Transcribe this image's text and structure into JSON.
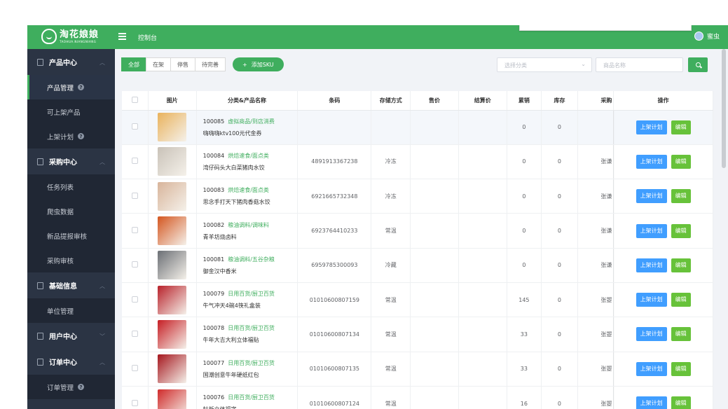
{
  "header": {
    "logo_cn": "淘花娘娘",
    "logo_en": "TAOHUA.NIANGNIANG",
    "title": "控制台",
    "user_name": "蜜虫"
  },
  "sidebar": {
    "groups": [
      {
        "label": "产品中心",
        "items": [
          {
            "label": "产品管理",
            "help": "?"
          },
          {
            "label": "可上架产品"
          },
          {
            "label": "上架计划",
            "help": "?"
          }
        ]
      },
      {
        "label": "采购中心",
        "items": [
          {
            "label": "任务列表"
          },
          {
            "label": "爬虫数据"
          },
          {
            "label": "新品提报审核"
          },
          {
            "label": "采购审核"
          }
        ]
      },
      {
        "label": "基础信息",
        "items": [
          {
            "label": "单位管理"
          }
        ]
      },
      {
        "label": "用户中心",
        "items": []
      },
      {
        "label": "订单中心",
        "items": [
          {
            "label": "订单管理",
            "help": "?"
          }
        ]
      }
    ]
  },
  "toolbar": {
    "filters": [
      "全部",
      "在架",
      "停售",
      "待完善"
    ],
    "add_sku": "添加SKU",
    "category_placeholder": "选择分类",
    "name_placeholder": "商品名称"
  },
  "table": {
    "headers": [
      "图片",
      "分类&产品名称",
      "条码",
      "存储方式",
      "售价",
      "结算价",
      "累销",
      "库存",
      "采购",
      "操作"
    ],
    "plan_label": "上架计划",
    "edit_label": "编辑",
    "rows": [
      {
        "id": "100085",
        "category": "虚拟商品/到店消费",
        "name": "嗨嗨嗨ktv100元代金券",
        "barcode": "",
        "storage": "",
        "price": "",
        "settle": "",
        "sales": "0",
        "stock": "0",
        "purchaser": "",
        "img_color": "#e9b25c"
      },
      {
        "id": "100084",
        "category": "烘焙速食/面点类",
        "name": "湾仔码头大白菜猪肉水饺",
        "barcode": "4891913367238",
        "storage": "冷冻",
        "price": "",
        "settle": "",
        "sales": "0",
        "stock": "0",
        "purchaser": "张谦",
        "img_color": "#c9c2b8"
      },
      {
        "id": "100083",
        "category": "烘焙速食/面点类",
        "name": "思念手打天下猪肉香菇水饺",
        "barcode": "6921665732348",
        "storage": "冷冻",
        "price": "",
        "settle": "",
        "sales": "0",
        "stock": "0",
        "purchaser": "张谦",
        "img_color": "#d8b49a"
      },
      {
        "id": "100082",
        "category": "粮油调料/调味料",
        "name": "青羊坊烧卤料",
        "barcode": "6923764410233",
        "storage": "常温",
        "price": "",
        "settle": "",
        "sales": "0",
        "stock": "0",
        "purchaser": "张谦",
        "img_color": "#d4561f"
      },
      {
        "id": "100081",
        "category": "粮油调料/五谷杂粮",
        "name": "御金汉中香米",
        "barcode": "6959785300093",
        "storage": "冷藏",
        "price": "",
        "settle": "",
        "sales": "0",
        "stock": "0",
        "purchaser": "张谦",
        "img_color": "#6b6f75"
      },
      {
        "id": "100079",
        "category": "日用百货/厨卫百货",
        "name": "牛气冲天4碗4筷礼盒装",
        "barcode": "01010600807159",
        "storage": "常温",
        "price": "",
        "settle": "",
        "sales": "145",
        "stock": "0",
        "purchaser": "张曌",
        "img_color": "#b8212a"
      },
      {
        "id": "100078",
        "category": "日用百货/厨卫百货",
        "name": "牛年大吉大利立体福贴",
        "barcode": "01010600807134",
        "storage": "常温",
        "price": "",
        "settle": "",
        "sales": "33",
        "stock": "0",
        "purchaser": "张曌",
        "img_color": "#c61e24"
      },
      {
        "id": "100077",
        "category": "日用百货/厨卫百货",
        "name": "国潮创意牛年硬纸红包",
        "barcode": "01010600807135",
        "storage": "常温",
        "price": "",
        "settle": "",
        "sales": "33",
        "stock": "0",
        "purchaser": "张曌",
        "img_color": "#a5161d"
      },
      {
        "id": "100076",
        "category": "日用百货/厨卫百货",
        "name": "蚨新立体福字",
        "barcode": "01010600807124",
        "storage": "常温",
        "price": "",
        "settle": "",
        "sales": "16",
        "stock": "0",
        "purchaser": "张曌",
        "img_color": "#d02a2a"
      }
    ]
  }
}
